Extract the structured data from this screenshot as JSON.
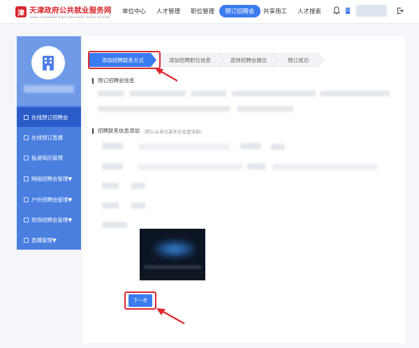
{
  "header": {
    "logo_cn": "天津政府公共就业服务网",
    "logo_en": "TIANJIN GOVERNMENT PUBLIC EMPLOYMENT SERVICE NETWORK",
    "nav": [
      {
        "label": "单位中心"
      },
      {
        "label": "人才管理"
      },
      {
        "label": "职位管理"
      },
      {
        "label": "预订招聘会"
      },
      {
        "label": "共享用工"
      },
      {
        "label": "人才搜索"
      }
    ],
    "active_index": 3
  },
  "sidebar": {
    "items": [
      {
        "label": "在线预订招聘会"
      },
      {
        "label": "在线预订直播"
      },
      {
        "label": "投递简历管理"
      },
      {
        "label": "网络招聘会管理▼"
      },
      {
        "label": "户外招聘会管理▼"
      },
      {
        "label": "现场招聘会管理▼"
      },
      {
        "label": "直播管理▼"
      }
    ],
    "active_index": 0
  },
  "steps": [
    {
      "label": "添加招聘联系方式"
    },
    {
      "label": "添加招聘职位信息"
    },
    {
      "label": "选择招聘会展位"
    },
    {
      "label": "预订成功"
    }
  ],
  "sections": {
    "reserve_info": "预订招聘会信息",
    "contact_info": "招聘联系信息添加",
    "contact_note": "(默认从单位基本信息里读取)"
  },
  "next_button": "下一步",
  "colors": {
    "brand_red": "#d8262c",
    "primary_blue": "#3b7bf0",
    "sidebar_blue": "#4a7fe0",
    "highlight_red": "#e0262c"
  }
}
